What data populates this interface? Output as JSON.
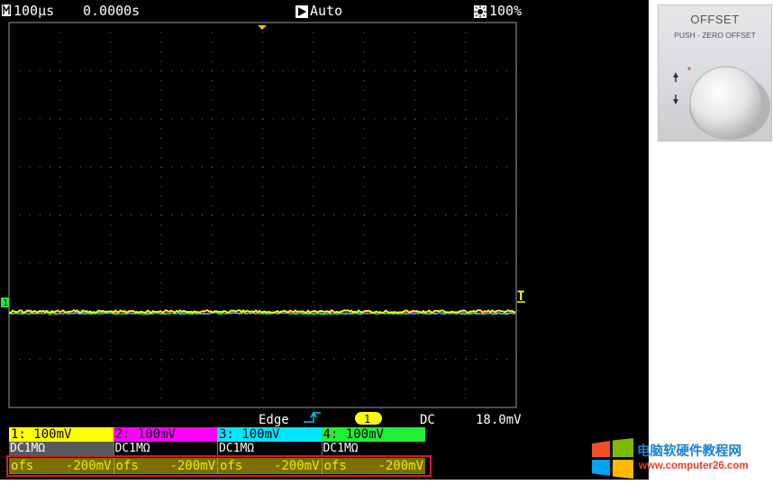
{
  "top_bar": {
    "timebase": "100µs",
    "position": "0.0000s",
    "trigger_mode": "Auto",
    "brightness": "100%"
  },
  "trigger": {
    "label": "Edge",
    "source": "1",
    "coupling": "DC",
    "level": "18.0mV",
    "level_marker": "T"
  },
  "channel_marker": "1",
  "channels": [
    {
      "scale": "1: 100mV",
      "coupling": "DC1MΩ",
      "offset_label": "ofs",
      "offset_value": "-200mV",
      "color": "#ffff00",
      "text_color": "#000000"
    },
    {
      "scale": "2: 100mV",
      "coupling": "DC1MΩ",
      "offset_label": "ofs",
      "offset_value": "-200mV",
      "color": "#ff00ff",
      "text_color": "#000000"
    },
    {
      "scale": "3: 100mV",
      "coupling": "DC1MΩ",
      "offset_label": "ofs",
      "offset_value": "-200mV",
      "color": "#00e5ff",
      "text_color": "#000000"
    },
    {
      "scale": "4: 100mV",
      "coupling": "DC1MΩ",
      "offset_label": "ofs",
      "offset_value": "-200mV",
      "color": "#22ee33",
      "text_color": "#000000"
    }
  ],
  "highlight_color": "#d11f1f",
  "knob": {
    "title": "OFFSET",
    "subtitle": "PUSH - ZERO OFFSET"
  },
  "watermark": {
    "title": "电脑软硬件教程网",
    "url": "www.computer26.com"
  }
}
